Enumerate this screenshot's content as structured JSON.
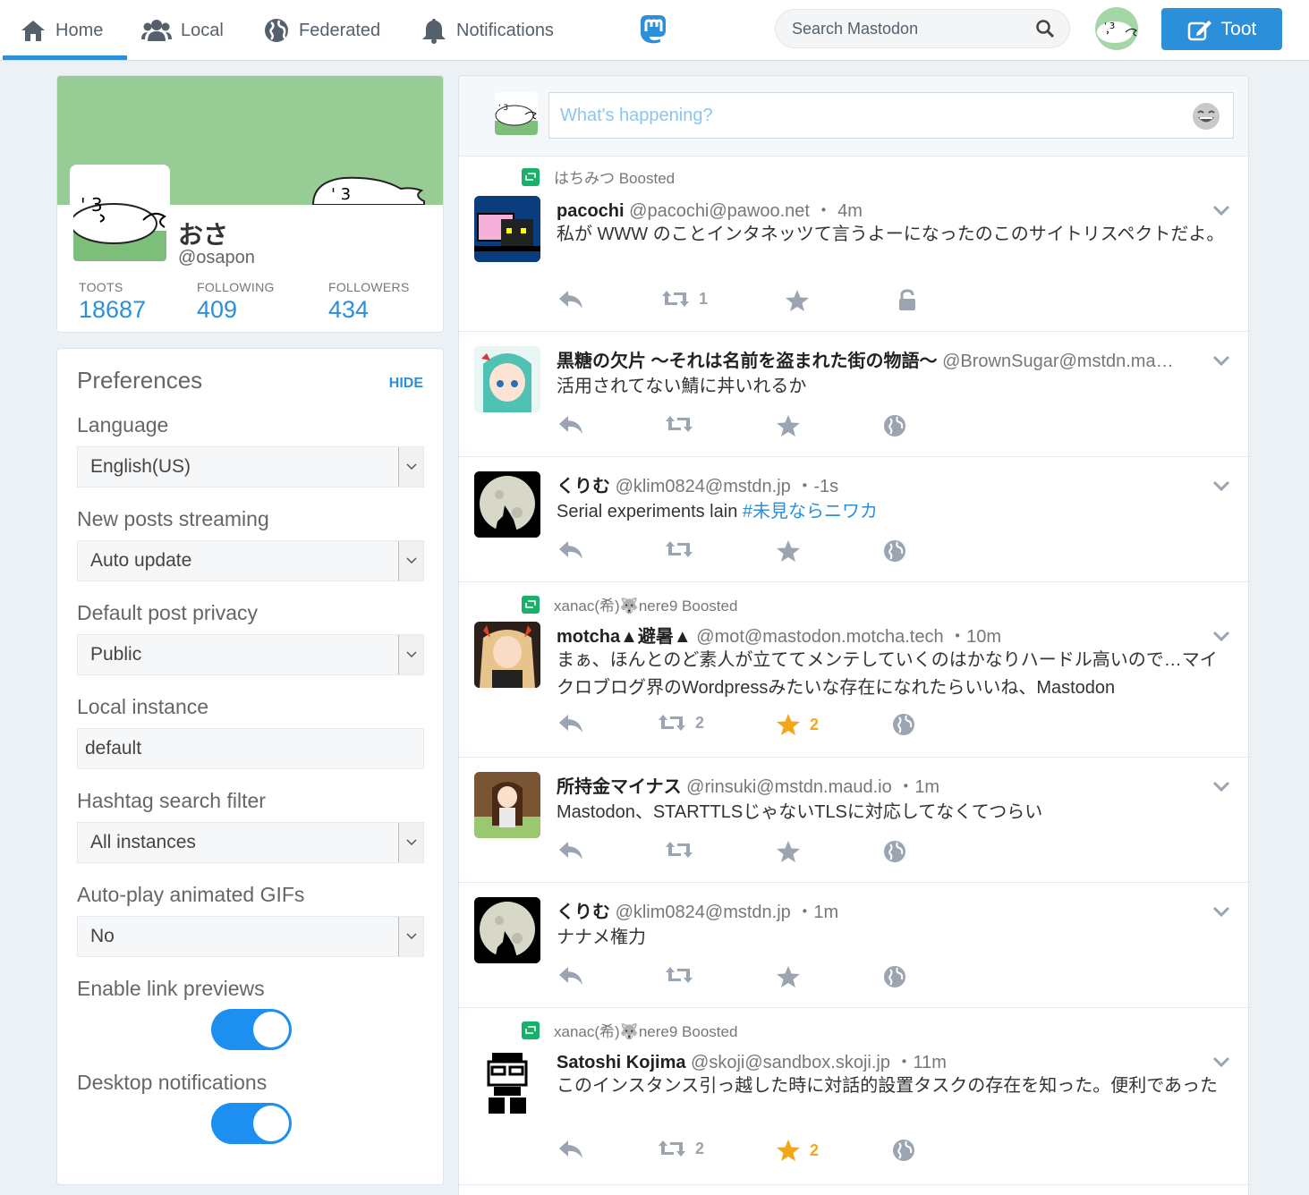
{
  "nav": {
    "home": "Home",
    "local": "Local",
    "federated": "Federated",
    "notifications": "Notifications",
    "search_placeholder": "Search Mastodon",
    "toot": "Toot"
  },
  "profile": {
    "name": "おさ",
    "handle": "@osapon",
    "stats": {
      "toots_label": "TOOTS",
      "toots": "18687",
      "following_label": "FOLLOWING",
      "following": "409",
      "followers_label": "FOLLOWERS",
      "followers": "434"
    }
  },
  "preferences": {
    "title": "Preferences",
    "hide": "HIDE",
    "language_label": "Language",
    "language": "English(US)",
    "streaming_label": "New posts streaming",
    "streaming": "Auto update",
    "privacy_label": "Default post privacy",
    "privacy": "Public",
    "local_instance_label": "Local instance",
    "local_instance": "default",
    "hashtag_label": "Hashtag search filter",
    "hashtag": "All instances",
    "autoplay_label": "Auto-play animated GIFs",
    "autoplay": "No",
    "link_previews_label": "Enable link previews",
    "link_previews": true,
    "desktop_notif_label": "Desktop notifications",
    "desktop_notif": true
  },
  "compose": {
    "placeholder": "What's happening?"
  },
  "statuses": [
    {
      "boosted_by": "はちみつ Boosted",
      "display_name": "pacochi",
      "acct": "@pacochi@pawoo.net",
      "time": "4m",
      "content": "私が WWW のことインタネッツて言うよーになったのこのサイトリスペクトだよ。",
      "reblogs": "1",
      "favs": "",
      "privacy": "unlisted"
    },
    {
      "boosted_by": "",
      "display_name": "黒糖の欠片 ～それは名前を盗まれた街の物語～",
      "acct": "@BrownSugar@mstdn.ma…",
      "time": "",
      "content": "活用されてない鯖に丼いれるか",
      "reblogs": "",
      "favs": "",
      "privacy": "public"
    },
    {
      "boosted_by": "",
      "display_name": "くりむ",
      "acct": "@klim0824@mstdn.jp",
      "time": "-1s",
      "content": "Serial experiments lain",
      "hashtag": "#未見ならニワカ",
      "reblogs": "",
      "favs": "",
      "privacy": "public"
    },
    {
      "boosted_by": "xanac(希)🐺nere9 Boosted",
      "display_name": "motcha▲避暑▲",
      "acct": "@mot@mastodon.motcha.tech",
      "time": "10m",
      "content": "まぁ、ほんとのど素人が立ててメンテしていくのはかなりハードル高いので…マイクロブログ界のWordpressみたいな存在になれたらいいね、Mastodon",
      "reblogs": "2",
      "favs": "2",
      "privacy": "public"
    },
    {
      "boosted_by": "",
      "display_name": "所持金マイナス",
      "acct": "@rinsuki@mstdn.maud.io",
      "time": "1m",
      "content": "Mastodon、STARTTLSじゃないTLSに対応してなくてつらい",
      "reblogs": "",
      "favs": "",
      "privacy": "public"
    },
    {
      "boosted_by": "",
      "display_name": "くりむ",
      "acct": "@klim0824@mstdn.jp",
      "time": "1m",
      "content": "ナナメ権力",
      "reblogs": "",
      "favs": "",
      "privacy": "public"
    },
    {
      "boosted_by": "xanac(希)🐺nere9 Boosted",
      "display_name": "Satoshi Kojima",
      "acct": "@skoji@sandbox.skoji.jp",
      "time": "11m",
      "content": "このインスタンス引っ越した時に対話的設置タスクの存在を知った。便利であった",
      "reblogs": "2",
      "favs": "2",
      "privacy": "public"
    }
  ],
  "colors": {
    "accent": "#2b90d9",
    "boost_green": "#19b06b",
    "fav_gold": "#f1a717",
    "header_green": "#98cc95"
  }
}
